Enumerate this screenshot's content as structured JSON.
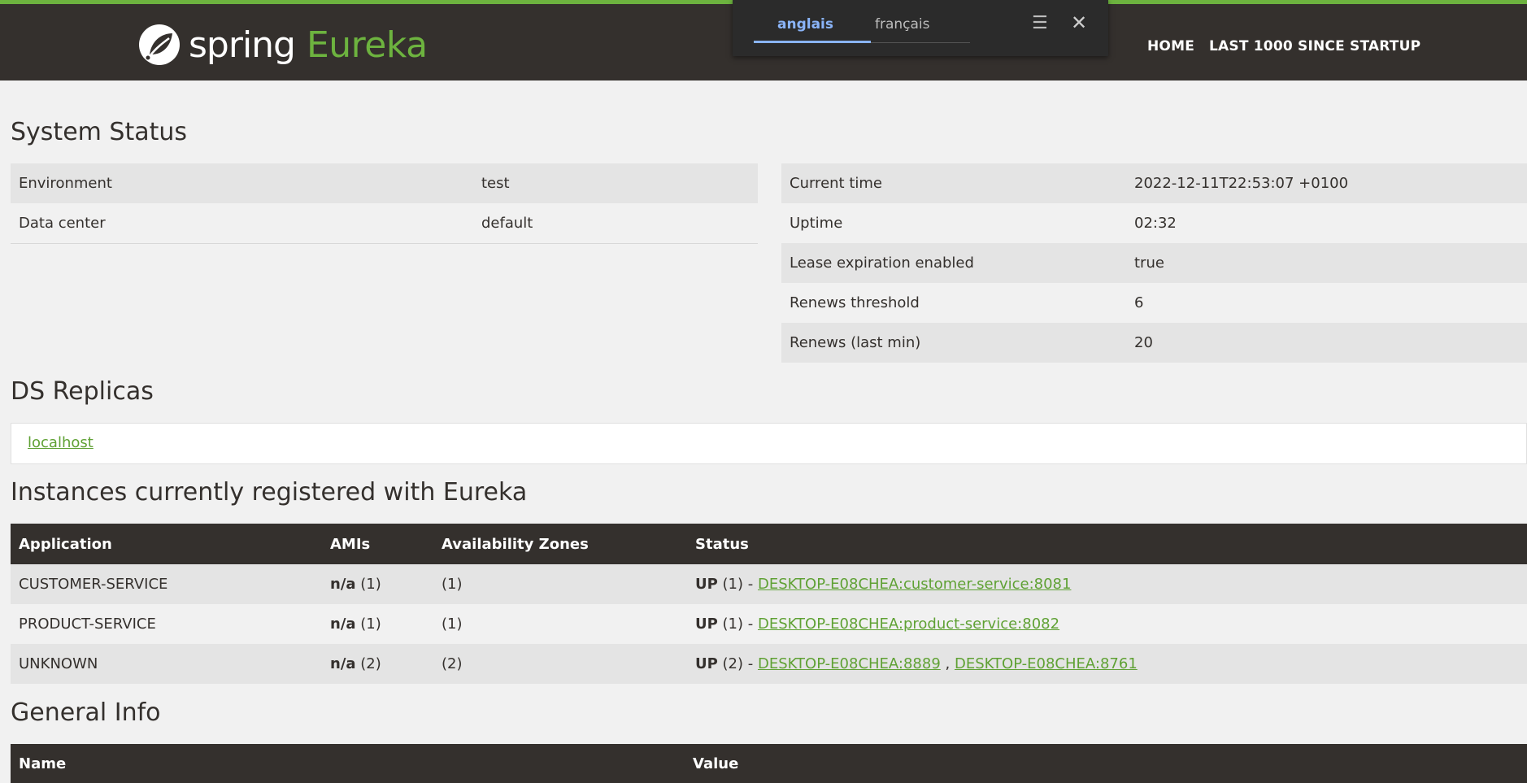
{
  "brand": {
    "spring": "spring",
    "eureka": "Eureka"
  },
  "nav": {
    "home": "HOME",
    "last1000": "LAST 1000 SINCE STARTUP"
  },
  "translate": {
    "tab_active": "anglais",
    "tab_inactive": "français",
    "menu_icon": "menu-icon",
    "close_icon": "close-icon"
  },
  "system_status": {
    "title": "System Status",
    "left": [
      {
        "label": "Environment",
        "value": "test"
      },
      {
        "label": "Data center",
        "value": "default"
      }
    ],
    "right": [
      {
        "label": "Current time",
        "value": "2022-12-11T22:53:07 +0100"
      },
      {
        "label": "Uptime",
        "value": "02:32"
      },
      {
        "label": "Lease expiration enabled",
        "value": "true"
      },
      {
        "label": "Renews threshold",
        "value": "6"
      },
      {
        "label": "Renews (last min)",
        "value": "20"
      }
    ]
  },
  "replicas": {
    "title": "DS Replicas",
    "link": "localhost"
  },
  "instances": {
    "title": "Instances currently registered with Eureka",
    "headers": [
      "Application",
      "AMIs",
      "Availability Zones",
      "Status"
    ],
    "rows": [
      {
        "app": "CUSTOMER-SERVICE",
        "ami_bold": "n/a",
        "ami_count": " (1)",
        "zones": "(1)",
        "status_bold": "UP",
        "status_rest": " (1) - ",
        "links": [
          "DESKTOP-E08CHEA:customer-service:8081"
        ]
      },
      {
        "app": "PRODUCT-SERVICE",
        "ami_bold": "n/a",
        "ami_count": " (1)",
        "zones": "(1)",
        "status_bold": "UP",
        "status_rest": " (1) - ",
        "links": [
          "DESKTOP-E08CHEA:product-service:8082"
        ]
      },
      {
        "app": "UNKNOWN",
        "ami_bold": "n/a",
        "ami_count": " (2)",
        "zones": "(2)",
        "status_bold": "UP",
        "status_rest": " (2) - ",
        "links": [
          "DESKTOP-E08CHEA:8889",
          "DESKTOP-E08CHEA:8761"
        ],
        "separator": " , "
      }
    ]
  },
  "general_info": {
    "title": "General Info",
    "headers": [
      "Name",
      "Value"
    ]
  }
}
